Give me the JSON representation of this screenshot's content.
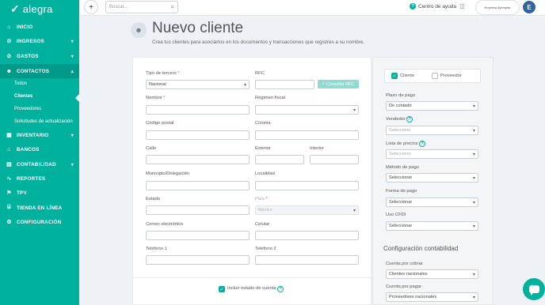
{
  "brand": {
    "name": "alegra",
    "logo_mark": "✓"
  },
  "sidebar": {
    "items": [
      {
        "label": "INICIO",
        "icon": "⌂"
      },
      {
        "label": "INGRESOS",
        "icon": "⊘",
        "chevron": "▾"
      },
      {
        "label": "GASTOS",
        "icon": "⊘",
        "chevron": "▾"
      },
      {
        "label": "CONTACTOS",
        "icon": "☻",
        "chevron": "▴"
      },
      {
        "label": "INVENTARIO",
        "icon": "▦",
        "chevron": "▾"
      },
      {
        "label": "BANCOS",
        "icon": "⌂"
      },
      {
        "label": "CONTABILIDAD",
        "icon": "▤",
        "chevron": "▾"
      },
      {
        "label": "REPORTES",
        "icon": "∿"
      },
      {
        "label": "TPV",
        "icon": "⚑"
      },
      {
        "label": "TIENDA EN LÍNEA",
        "icon": "⌸"
      },
      {
        "label": "CONFIGURACIÓN",
        "icon": "⚙"
      }
    ],
    "sub_items": [
      {
        "label": "Todos"
      },
      {
        "label": "Clientes"
      },
      {
        "label": "Proveedores"
      },
      {
        "label": "Solicitudes de actualización"
      }
    ]
  },
  "topbar": {
    "plus": "+",
    "search_placeholder": "Buscar...",
    "search_icon": "⌕",
    "help_icon": "?",
    "help_label": "Centro de ayuda",
    "apps_icon": "⁞⁞⁞",
    "company_label": "Empresa Ejemplar",
    "avatar_initial": "E"
  },
  "header": {
    "icon": "☻",
    "title": "Nuevo cliente",
    "subtitle": "Crea tus clientes para asociarlos en los documentos y transacciones que registres a su nombre."
  },
  "form": {
    "tipo_tercero_label": "Tipo de tercero",
    "required_mark": "*",
    "tipo_tercero_value": "Nacional",
    "rfc_label": "RFC",
    "rfc_button": "Consultar RFC",
    "rfc_button_icon": "⌕",
    "nombre_label": "Nombre",
    "regimen_label": "Régimen fiscal",
    "cp_label": "Código postal",
    "colonia_label": "Colonia",
    "calle_label": "Calle",
    "exterior_label": "Exterior",
    "interior_label": "Interior",
    "municipio_label": "Municipio/Delegación",
    "localidad_label": "Localidad",
    "estado_label": "Estado",
    "pais_label": "País",
    "pais_value": "México",
    "correo_label": "Correo electrónico",
    "celular_label": "Celular",
    "telefono1_label": "Teléfono 1",
    "telefono2_label": "Teléfono 2",
    "incluir_label": "Incluir estado de cuenta",
    "help_q": "?"
  },
  "panel": {
    "cliente_label": "Cliente",
    "proveedor_label": "Proveedor",
    "check_mark": "✓",
    "plazo_label": "Plazo de pago",
    "plazo_value": "De contado",
    "vendedor_label": "Vendedor",
    "vendedor_placeholder": "Seleccione",
    "lista_label": "Lista de precios",
    "lista_placeholder": "Seleccione",
    "metodo_label": "Método de pago",
    "metodo_value": "Seleccionar",
    "forma_label": "Forma de pago",
    "forma_value": "Seleccionar",
    "cfdi_label": "Uso CFDI",
    "cfdi_value": "Seleccionar",
    "contable_title": "Configuración contabilidad",
    "cxc_label": "Cuenta por cobrar",
    "cxc_value": "Clientes nacionales",
    "cxp_label": "Cuenta por pagar",
    "cxp_value": "Proveedores nacionales"
  },
  "colors": {
    "brand": "#00b19d",
    "brand_dark": "#00998a",
    "avatar": "#2f63a4"
  }
}
